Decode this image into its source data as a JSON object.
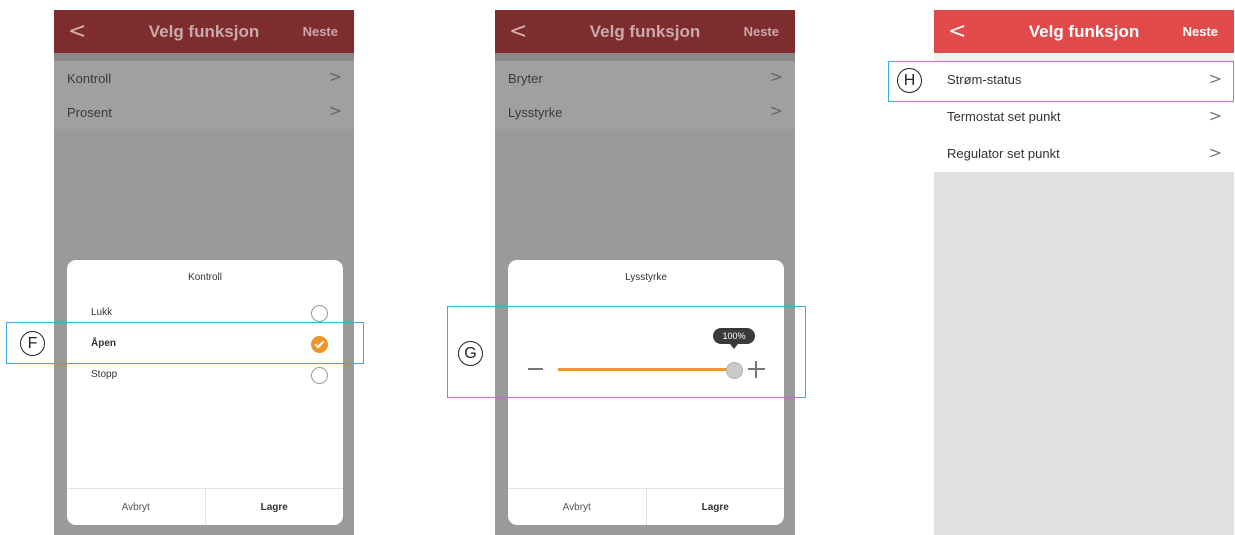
{
  "colors": {
    "header_active": "#e04a4a",
    "header_dimmed": "#7d2d2e",
    "accent_orange": "#f0952b",
    "overlay_gray": "#9a9a9a",
    "callout_blue": "#3fa9e0"
  },
  "header": {
    "back_icon": "chevron-left-icon",
    "back_glyph": "<",
    "title": "Velg funksjon",
    "next_label": "Neste"
  },
  "chevron_glyph": ">",
  "screen_f": {
    "list": [
      {
        "label": "Kontroll"
      },
      {
        "label": "Prosent"
      }
    ],
    "sheet": {
      "title": "Kontroll",
      "options": [
        {
          "label": "Lukk",
          "selected": false
        },
        {
          "label": "Åpen",
          "selected": true
        },
        {
          "label": "Stopp",
          "selected": false
        }
      ],
      "cancel_label": "Avbryt",
      "save_label": "Lagre"
    },
    "marker": "F"
  },
  "screen_g": {
    "list": [
      {
        "label": "Bryter"
      },
      {
        "label": "Lysstyrke"
      }
    ],
    "sheet": {
      "title": "Lysstyrke",
      "slider_value_percent": 100,
      "slider_tooltip": "100%",
      "cancel_label": "Avbryt",
      "save_label": "Lagre"
    },
    "marker": "G"
  },
  "screen_h": {
    "list": [
      {
        "label": "Strøm-status"
      },
      {
        "label": "Termostat set punkt"
      },
      {
        "label": "Regulator set punkt"
      }
    ],
    "marker": "H"
  }
}
